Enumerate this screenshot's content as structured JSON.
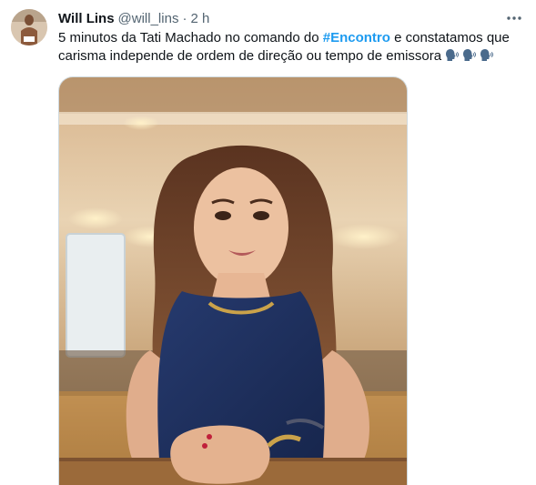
{
  "tweet": {
    "author": {
      "display_name": "Will Lins",
      "handle": "@will_lins",
      "separator": "·",
      "time": "2 h"
    },
    "text_before": "5 minutos da Tati Machado no comando do ",
    "hashtag": "#Encontro",
    "text_after": " e constatamos que carisma independe de ordem de direção ou tempo de emissora",
    "emoji_icons": [
      "speaking-head-icon",
      "speaking-head-icon",
      "speaking-head-icon"
    ],
    "more_icon": "more-horizontal-icon",
    "media": {
      "type": "photo",
      "icon": "photo-woman-at-table"
    }
  },
  "colors": {
    "link": "#1d9bf0",
    "text": "#0f1419",
    "secondary": "#536471",
    "dress": "#1f2f5c",
    "hair": "#6b3f24"
  }
}
